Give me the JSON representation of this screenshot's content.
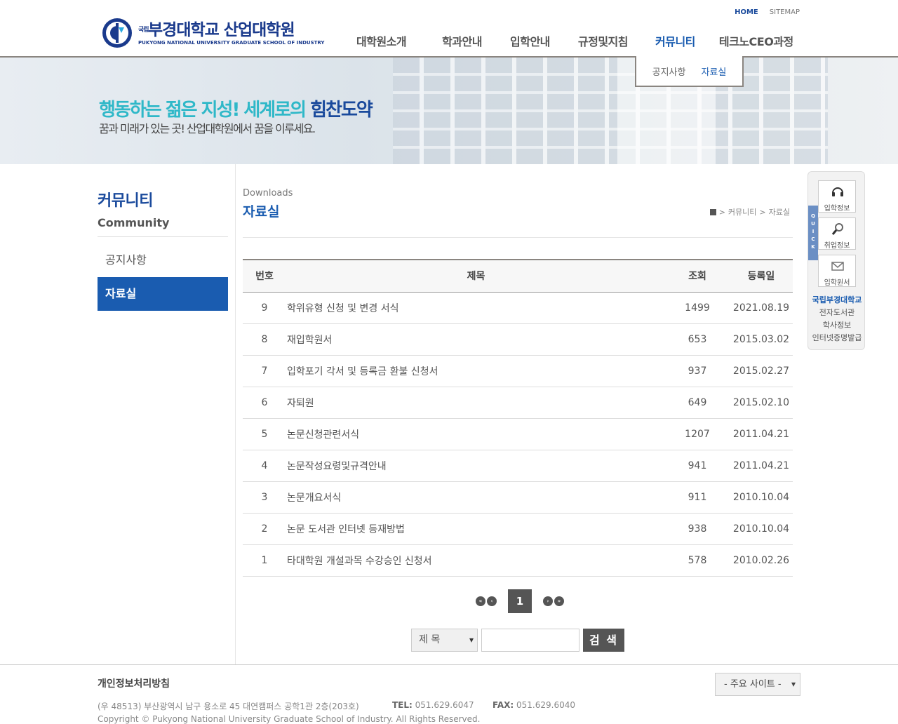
{
  "header": {
    "logo_ko": "부경대학교 산업대학원",
    "logo_ko_prefix": "국립",
    "logo_en": "PUKYONG NATIONAL UNIVERSITY  GRADUATE SCHOOL OF INDUSTRY",
    "top_links": [
      "HOME",
      "SITEMAP"
    ],
    "gnb": [
      "대학원소개",
      "학과안내",
      "입학안내",
      "규정및지침",
      "커뮤니티",
      "테크노CEO과정"
    ],
    "gnb_active": "커뮤니티"
  },
  "banner": {
    "slogan_main": "행동하는 젊은 지성! 세계로의 ",
    "slogan_emph": "힘찬도약",
    "slogan_sub": "꿈과 미래가 있는 곳! 산업대학원에서 꿈을 이루세요."
  },
  "subtabs": [
    "공지사항",
    "자료실"
  ],
  "lnb": {
    "title": "커뮤니티",
    "subtitle": "Community",
    "items": [
      "공지사항",
      "자료실"
    ]
  },
  "content": {
    "title_en": "Downloads",
    "title": "자료실",
    "breadcrumb": [
      "커뮤니티",
      "자료실"
    ]
  },
  "table": {
    "headers": [
      "번호",
      "제목",
      "조회",
      "등록일"
    ],
    "rows": [
      {
        "no": "9",
        "title": "학위유형 신청 및 변경 서식",
        "hits": "1499",
        "date": "2021.08.19"
      },
      {
        "no": "8",
        "title": "재입학원서",
        "hits": "653",
        "date": "2015.03.02"
      },
      {
        "no": "7",
        "title": "입학포기 각서 및 등록금 환불 신청서",
        "hits": "937",
        "date": "2015.02.27"
      },
      {
        "no": "6",
        "title": "자퇴원",
        "hits": "649",
        "date": "2015.02.10"
      },
      {
        "no": "5",
        "title": "논문신청관련서식",
        "hits": "1207",
        "date": "2011.04.21"
      },
      {
        "no": "4",
        "title": "논문작성요령및규격안내",
        "hits": "941",
        "date": "2011.04.21"
      },
      {
        "no": "3",
        "title": "논문개요서식",
        "hits": "911",
        "date": "2010.10.04"
      },
      {
        "no": "2",
        "title": "논문 도서관 인터넷 등재방법",
        "hits": "938",
        "date": "2010.10.04"
      },
      {
        "no": "1",
        "title": "타대학원 개설과목 수강승인 신청서",
        "hits": "578",
        "date": "2010.02.26"
      }
    ]
  },
  "pager": {
    "current": "1"
  },
  "search": {
    "field": "제 목",
    "button": "검 색"
  },
  "quick": {
    "tab": "QUICK",
    "buttons": [
      "입학정보",
      "취업정보",
      "입학원서"
    ],
    "links": [
      "국립부경대학교",
      "전자도서관",
      "학사정보",
      "인터넷증명발급"
    ]
  },
  "footer": {
    "privacy": "개인정보처리방침",
    "address": "(우 48513) 부산광역시 남구 용소로 45 대연캠퍼스 공학1관 2층(203호)",
    "tel_label": "TEL:",
    "tel": "051.629.6047",
    "fax_label": "FAX:",
    "fax": "051.629.6040",
    "copyright": "Copyright © Pukyong National University Graduate School of Industry. All Rights Reserved.",
    "site_select": "- 주요 사이트 -"
  },
  "colors": {
    "brand_blue": "#1a5cb0",
    "accent_cyan": "#2fb8c8",
    "dark_gray": "#555555"
  }
}
